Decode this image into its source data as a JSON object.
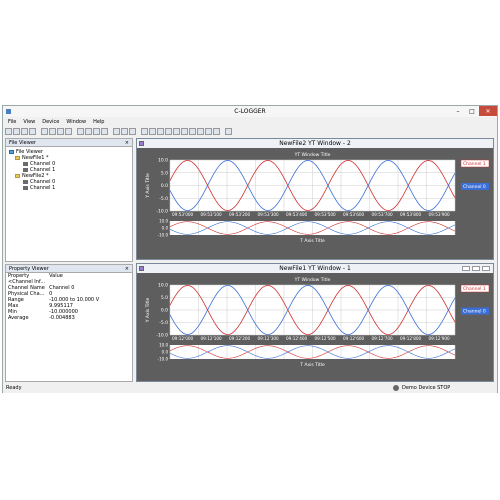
{
  "app": {
    "title": "C-LOGGER"
  },
  "menu": [
    "File",
    "View",
    "Device",
    "Window",
    "Help"
  ],
  "file_viewer": {
    "title": "File Viewer",
    "close": "×",
    "tree": [
      {
        "label": "File Viewer",
        "level": 0,
        "kind": "root"
      },
      {
        "label": "NewFile1 *",
        "level": 1,
        "kind": "folder"
      },
      {
        "label": "Channel 0",
        "level": 2,
        "kind": "channel"
      },
      {
        "label": "Channel 1",
        "level": 2,
        "kind": "channel"
      },
      {
        "label": "NewFile2 *",
        "level": 1,
        "kind": "folder"
      },
      {
        "label": "Channel 0",
        "level": 2,
        "kind": "channel"
      },
      {
        "label": "Channel 1",
        "level": 2,
        "kind": "channel"
      }
    ]
  },
  "property_viewer": {
    "title": "Property Viewer",
    "close": "×",
    "headers": [
      "Property",
      "Value"
    ],
    "rows": [
      [
        "<Channel Inf...",
        ""
      ],
      [
        "Channel Name",
        "Channel 0"
      ],
      [
        "Physical Cha...",
        "0"
      ],
      [
        "Range",
        "-10.000 to 10.000 V"
      ],
      [
        "Max",
        "9.995117"
      ],
      [
        "Min",
        "-10.000000"
      ],
      [
        "Average",
        "-0.004883"
      ]
    ]
  },
  "yt_windows": [
    {
      "title": "NewFile2 YT Window - 2",
      "plot_title": "YT Window Title",
      "y_axis_title": "Y Axis Title",
      "x_axis_title": "T Axis Title",
      "y_ticks": [
        "10.0",
        "5.0",
        "0.0",
        "-5.0",
        "-10.0"
      ],
      "sub_y_ticks": [
        "10.0",
        "0.0",
        "-10.0"
      ],
      "x_ticks": [
        "09:53'000",
        "09:53'100",
        "09:53'200",
        "09:53'300",
        "09:53'400",
        "09:53'500",
        "09:53'600",
        "09:53'700",
        "09:53'800",
        "09:53'900"
      ]
    },
    {
      "title": "NewFile1 YT Window - 1",
      "plot_title": "YT Window Title",
      "y_axis_title": "Y Axis Title",
      "x_axis_title": "T Axis Title",
      "y_ticks": [
        "10.0",
        "5.0",
        "0.0",
        "-5.0",
        "-10.0"
      ],
      "sub_y_ticks": [
        "10.0",
        "0.0",
        "-10.0"
      ],
      "x_ticks": [
        "09:12'000",
        "09:12'100",
        "09:12'200",
        "09:12'300",
        "09:12'400",
        "09:12'500",
        "09:12'600",
        "09:12'700",
        "09:12'800",
        "09:12'900"
      ]
    }
  ],
  "legend": {
    "ch1": {
      "label": "Channel 1",
      "color": "#d03030"
    },
    "ch0": {
      "label": "Channel 0",
      "color": "#3a6fd8"
    }
  },
  "status": {
    "left": "Ready",
    "right": "Demo Device STOP"
  },
  "colors": {
    "plot_bg": "#ffffff",
    "frame": "#5e5e5e",
    "grid": "#cccccc"
  }
}
